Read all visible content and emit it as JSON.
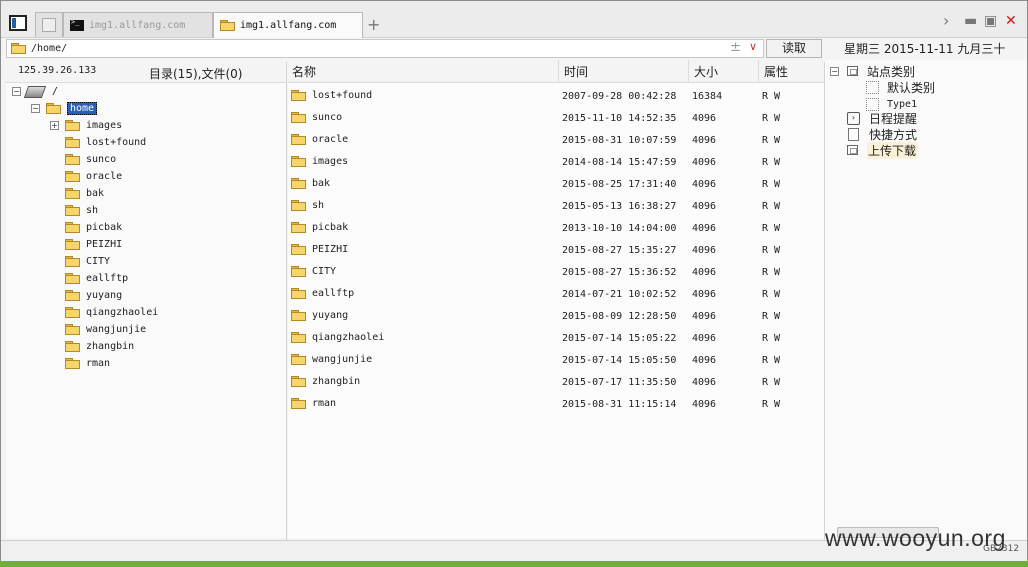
{
  "tabs": [
    {
      "label": ""
    },
    {
      "label": "img1.allfang.com"
    },
    {
      "label": "img1.allfang.com"
    }
  ],
  "add_tab": "+",
  "window_controls": {
    "chevron": "›",
    "minimize": "▬",
    "maximize": "▣",
    "close": "✕"
  },
  "address": {
    "path": "/home/",
    "plus": "±",
    "dropdown": "∨"
  },
  "goto_label": "读取",
  "datetime": "星期三 2015-11-11 九月三十",
  "left": {
    "ip": "125.39.26.133",
    "counts": "目录(15),文件(0)",
    "root": "/",
    "home": "home",
    "children": [
      "images",
      "lost+found",
      "sunco",
      "oracle",
      "bak",
      "sh",
      "picbak",
      "PEIZHI",
      "CITY",
      "eallftp",
      "yuyang",
      "qiangzhaolei",
      "wangjunjie",
      "zhangbin",
      "rman"
    ]
  },
  "columns": {
    "name": "名称",
    "time": "时间",
    "size": "大小",
    "attr": "属性"
  },
  "files": [
    {
      "name": "lost+found",
      "time": "2007-09-28 00:42:28",
      "size": "16384",
      "attr": "R W"
    },
    {
      "name": "sunco",
      "time": "2015-11-10 14:52:35",
      "size": "4096",
      "attr": "R W"
    },
    {
      "name": "oracle",
      "time": "2015-08-31 10:07:59",
      "size": "4096",
      "attr": "R W"
    },
    {
      "name": "images",
      "time": "2014-08-14 15:47:59",
      "size": "4096",
      "attr": "R W"
    },
    {
      "name": "bak",
      "time": "2015-08-25 17:31:40",
      "size": "4096",
      "attr": "R W"
    },
    {
      "name": "sh",
      "time": "2015-05-13 16:38:27",
      "size": "4096",
      "attr": "R W"
    },
    {
      "name": "picbak",
      "time": "2013-10-10 14:04:00",
      "size": "4096",
      "attr": "R W"
    },
    {
      "name": "PEIZHI",
      "time": "2015-08-27 15:35:27",
      "size": "4096",
      "attr": "R W"
    },
    {
      "name": "CITY",
      "time": "2015-08-27 15:36:52",
      "size": "4096",
      "attr": "R W"
    },
    {
      "name": "eallftp",
      "time": "2014-07-21 10:02:52",
      "size": "4096",
      "attr": "R W"
    },
    {
      "name": "yuyang",
      "time": "2015-08-09 12:28:50",
      "size": "4096",
      "attr": "R W"
    },
    {
      "name": "qiangzhaolei",
      "time": "2015-07-14 15:05:22",
      "size": "4096",
      "attr": "R W"
    },
    {
      "name": "wangjunjie",
      "time": "2015-07-14 15:05:50",
      "size": "4096",
      "attr": "R W"
    },
    {
      "name": "zhangbin",
      "time": "2015-07-17 11:35:50",
      "size": "4096",
      "attr": "R W"
    },
    {
      "name": "rman",
      "time": "2015-08-31 11:15:14",
      "size": "4096",
      "attr": "R W"
    }
  ],
  "right": {
    "site_category": "站点类别",
    "default_category": "默认类别",
    "type1": "Type1",
    "schedule": "日程提醒",
    "shortcut": "快捷方式",
    "upload_download": "上传下载"
  },
  "watermark": "www.wooyun.org",
  "encoding": "GB2312",
  "colors": {
    "selection": "#2a5fb5",
    "close": "#dd1111",
    "folder": "#f6d66a"
  }
}
